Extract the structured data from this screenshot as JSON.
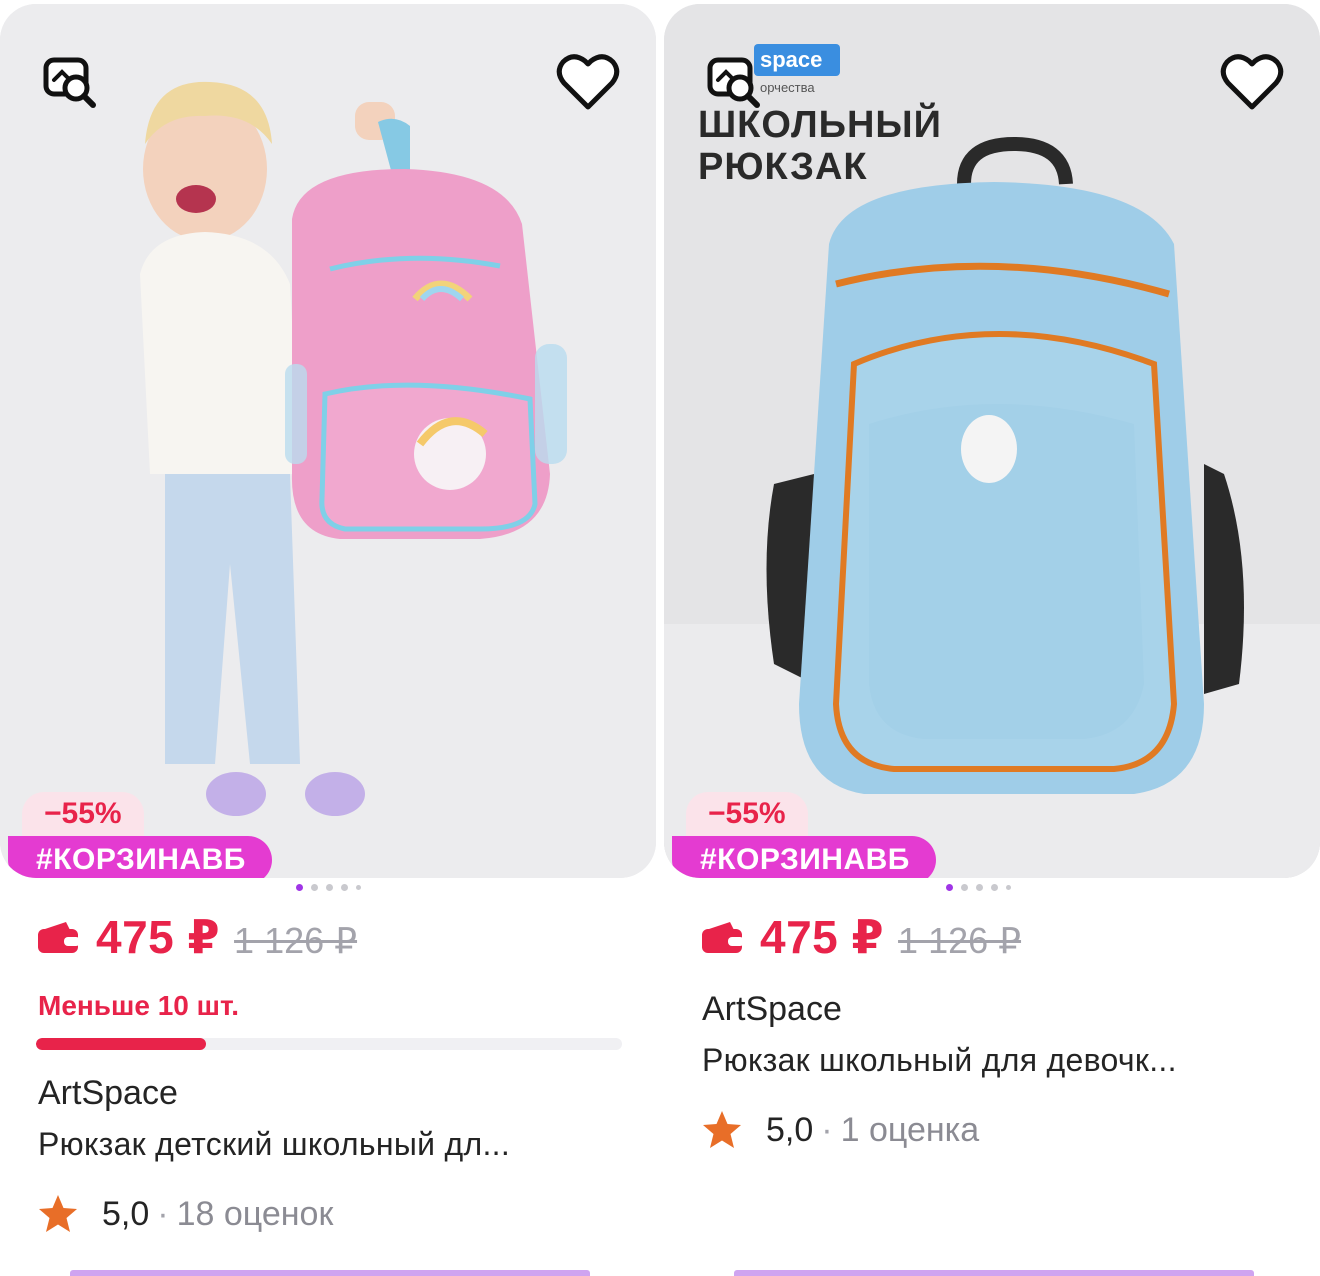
{
  "products": [
    {
      "discount": "−55%",
      "tag": "#КОРЗИНАВБ",
      "price": "475 ₽",
      "old_price": "1 126 ₽",
      "stock_text": "Меньше 10 шт.",
      "stock_level": 0.29,
      "brand": "ArtSpace",
      "title": "Рюкзак детский школьный дл...",
      "rating": "5,0",
      "rating_sep": "·",
      "reviews": "18 оценок",
      "image_dots": 5,
      "active_dot": 0
    },
    {
      "discount": "−55%",
      "tag": "#КОРЗИНАВБ",
      "price": "475 ₽",
      "old_price": "1 126 ₽",
      "brand": "ArtSpace",
      "title": "Рюкзак школьный для девочк...",
      "rating": "5,0",
      "rating_sep": "·",
      "reviews": "1 оценка",
      "image_overlay": {
        "logo": "space",
        "logo_sub": "орчества",
        "line1": "ШКОЛЬНЫЙ",
        "line2": "РЮКЗАК"
      },
      "image_dots": 5,
      "active_dot": 0
    }
  ],
  "colors": {
    "price": "#e8234a",
    "tag_bg": "#e43bd1",
    "discount_bg": "#fbe3ea",
    "star": "#e86e28",
    "dot_active": "#a035e6"
  },
  "icons": [
    "image-search-icon",
    "heart-icon",
    "wallet-icon",
    "star-icon"
  ]
}
